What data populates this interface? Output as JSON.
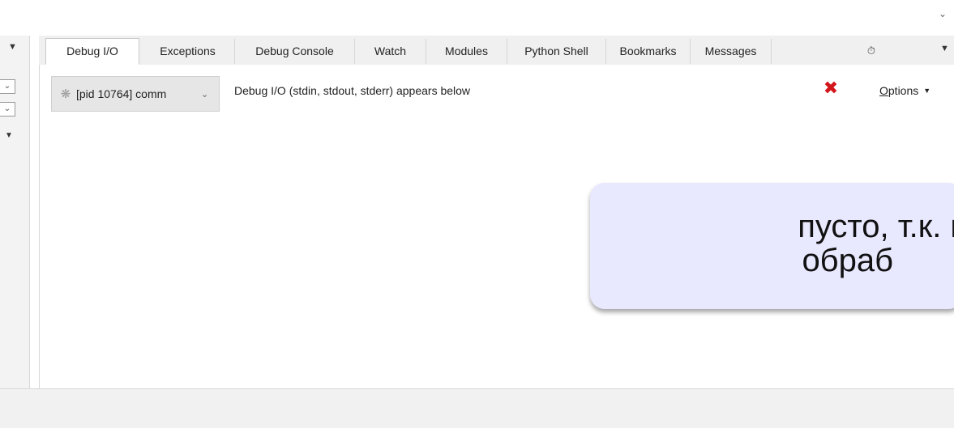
{
  "window": {
    "corner_icon": "chevron-down-icon"
  },
  "tabs": [
    {
      "label": "Debug I/O",
      "active": true
    },
    {
      "label": "Exceptions"
    },
    {
      "label": "Debug Console"
    },
    {
      "label": "Watch"
    },
    {
      "label": "Modules"
    },
    {
      "label": "Python Shell"
    },
    {
      "label": "Bookmarks"
    },
    {
      "label": "Messages"
    }
  ],
  "debug_io": {
    "process_select": "[pid 10764] comm",
    "description": "Debug I/O (stdin, stdout, stderr) appears below",
    "options_mnemonic": "O",
    "options_rest": "ptions"
  },
  "callout": {
    "line1": "пусто, т.к. к",
    "line2": "обраб",
    "background": "#e8e8ff"
  },
  "colors": {
    "close": "#d2161a",
    "active_tab": "#ffffff",
    "tabbar": "#f0f0f0"
  }
}
